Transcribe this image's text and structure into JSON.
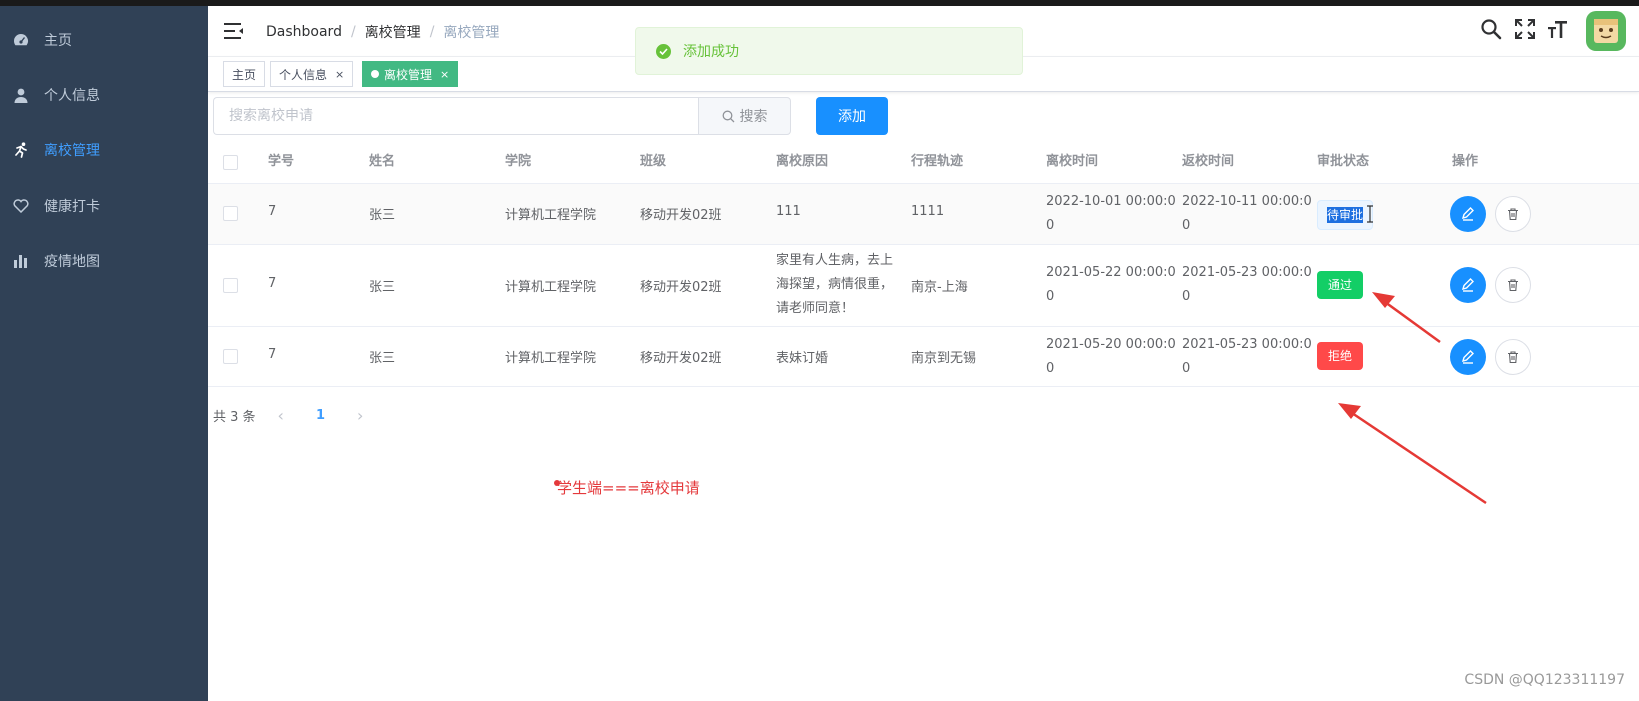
{
  "sidebar": {
    "items": [
      {
        "label": "主页",
        "icon": "dashboard-icon"
      },
      {
        "label": "个人信息",
        "icon": "user-icon"
      },
      {
        "label": "离校管理",
        "icon": "running-icon",
        "active": true
      },
      {
        "label": "健康打卡",
        "icon": "heart-icon"
      },
      {
        "label": "疫情地图",
        "icon": "chart-icon"
      }
    ]
  },
  "breadcrumb": [
    "Dashboard",
    "离校管理",
    "离校管理"
  ],
  "toast": {
    "text": "添加成功"
  },
  "tags": [
    {
      "label": "主页"
    },
    {
      "label": "个人信息",
      "close": "×"
    },
    {
      "label": "离校管理",
      "close": "×",
      "active": true
    }
  ],
  "search": {
    "placeholder": "搜索离校申请",
    "button_label": "搜索"
  },
  "add_button": "添加",
  "table": {
    "headers": [
      "学号",
      "姓名",
      "学院",
      "班级",
      "离校原因",
      "行程轨迹",
      "离校时间",
      "返校时间",
      "审批状态",
      "操作"
    ],
    "rows": [
      {
        "id": "7",
        "name": "张三",
        "college": "计算机工程学院",
        "class": "移动开发02班",
        "reason": "111",
        "route": "1111",
        "leave_time": [
          "2022-10-01 00:00:0",
          "0"
        ],
        "return_time": [
          "2022-10-11 00:00:0",
          "0"
        ],
        "status": "待审批"
      },
      {
        "id": "7",
        "name": "张三",
        "college": "计算机工程学院",
        "class": "移动开发02班",
        "reason": [
          "家里有人生病，去上",
          "海探望，病情很重，",
          "请老师同意！"
        ],
        "route": "南京-上海",
        "leave_time": [
          "2021-05-22 00:00:0",
          "0"
        ],
        "return_time": [
          "2021-05-23 00:00:0",
          "0"
        ],
        "status": "通过"
      },
      {
        "id": "7",
        "name": "张三",
        "college": "计算机工程学院",
        "class": "移动开发02班",
        "reason": "表妹订婚",
        "route": "南京到无锡",
        "leave_time": [
          "2021-05-20 00:00:0",
          "0"
        ],
        "return_time": [
          "2021-05-23 00:00:0",
          "0"
        ],
        "status": "拒绝"
      }
    ]
  },
  "pagination": {
    "total": "共 3 条",
    "current": "1"
  },
  "caption": "学生端===离校申请",
  "watermark": "CSDN @QQ123311197",
  "colors": {
    "sidebar": "#304156",
    "accent": "#1890ff",
    "pass": "#13ce66",
    "reject": "#ff4949",
    "tag_active": "#42b983"
  }
}
